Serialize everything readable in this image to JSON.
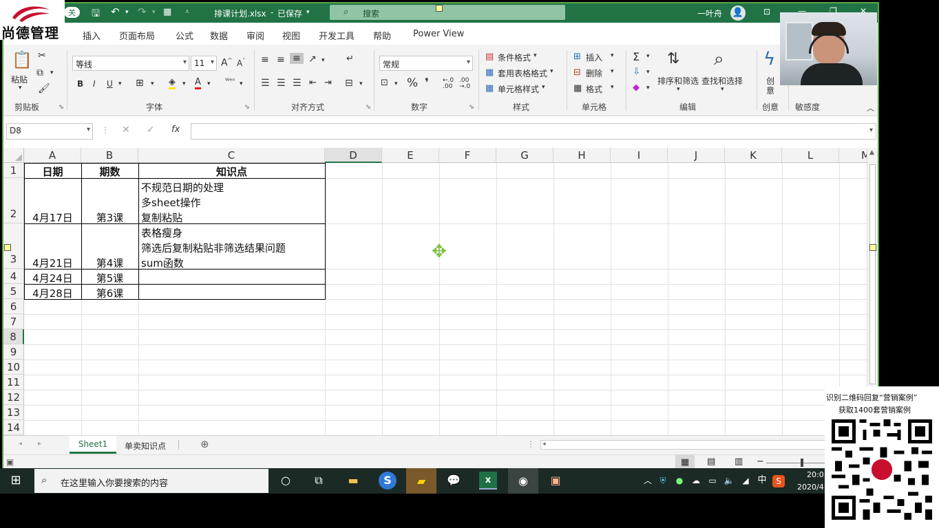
{
  "brand": {
    "name": "尚德管理"
  },
  "title": {
    "autosave_label": "关",
    "filename": "排课计划.xlsx",
    "save_state": "已保存",
    "search_label": "搜索",
    "user": "一叶舟"
  },
  "tabs": [
    "插入",
    "页面布局",
    "公式",
    "数据",
    "审阅",
    "视图",
    "开发工具",
    "帮助",
    "Power View"
  ],
  "ribbon": {
    "clipboard": {
      "paste": "粘贴",
      "group": "剪贴板"
    },
    "font": {
      "name": "等线",
      "size": "11",
      "bold": "B",
      "italic": "I",
      "underline": "U",
      "group": "字体"
    },
    "align": {
      "group": "对齐方式"
    },
    "number": {
      "format": "常规",
      "percent": "%",
      "comma": "❜",
      "group": "数字"
    },
    "styles": {
      "cond": "条件格式",
      "table": "套用表格格式",
      "cell": "单元格样式",
      "group": "样式"
    },
    "cells": {
      "insert": "插入",
      "delete": "删除",
      "format": "格式",
      "group": "单元格"
    },
    "editing": {
      "sort": "排序和筛选",
      "find": "查找和选择",
      "group": "编辑"
    },
    "idea": {
      "label1": "创",
      "label2": "意",
      "group": "创意"
    },
    "sensitivity": {
      "group": "敏感度"
    }
  },
  "formula_bar": {
    "name_box": "D8",
    "fx": "fx",
    "formula": ""
  },
  "columns": [
    "A",
    "B",
    "C",
    "D",
    "E",
    "F",
    "G",
    "H",
    "I",
    "J",
    "K",
    "L",
    "M"
  ],
  "rows": [
    "1",
    "2",
    "3",
    "4",
    "5",
    "6",
    "7",
    "8",
    "9",
    "10",
    "11",
    "12",
    "13",
    "14"
  ],
  "table": {
    "headers": [
      "日期",
      "期数",
      "知识点"
    ],
    "rows": [
      {
        "date": "4月17日",
        "period": "第3课",
        "points": [
          "不规范日期的处理",
          "多sheet操作",
          "复制粘贴"
        ]
      },
      {
        "date": "4月21日",
        "period": "第4课",
        "points": [
          "表格瘦身",
          "筛选后复制粘贴非筛选结果问题",
          "sum函数"
        ]
      },
      {
        "date": "4月24日",
        "period": "第5课",
        "points": []
      },
      {
        "date": "4月28日",
        "period": "第6课",
        "points": []
      }
    ]
  },
  "sheets": [
    "Sheet1",
    "单卖知识点"
  ],
  "taskbar": {
    "search_placeholder": "在这里输入你要搜索的内容",
    "time": "20:0",
    "date": "2020/4",
    "ime": "中"
  },
  "promo": {
    "line1": "识别二维码回复“营销案例”",
    "line2": "获取1400套营销案例"
  },
  "colors": {
    "excel_green": "#217346",
    "accent_red": "#c8102e"
  }
}
